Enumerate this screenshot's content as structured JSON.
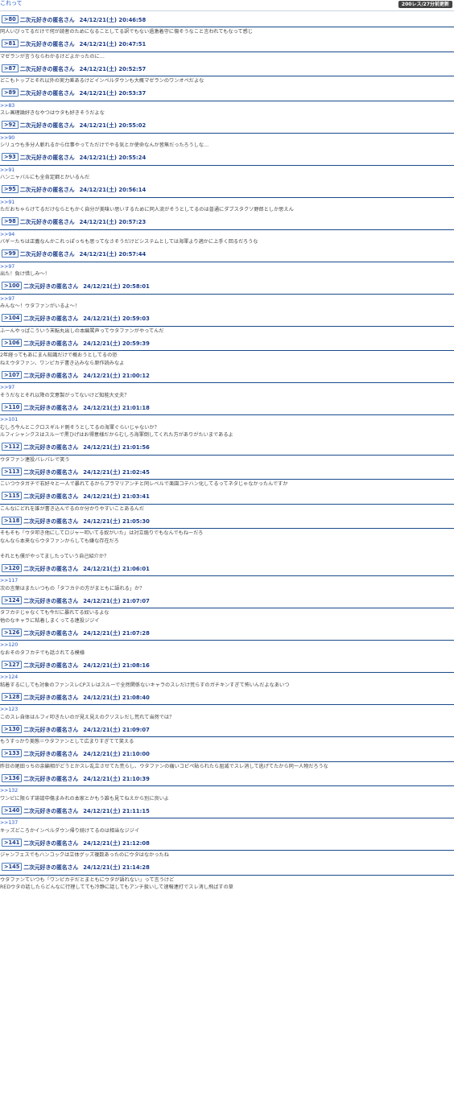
{
  "header": {
    "link_text": "これって",
    "count_badge": "200レス/27分前更新"
  },
  "posts": [
    {
      "num": "80",
      "name": "二次元好きの匿名さん",
      "date": "24/12/21(土) 20:46:58",
      "body": [
        "同人いびってるだけで何が読者のためになることしてる訳でもない過激着守に傷そうなこと言われてもなって感じ"
      ]
    },
    {
      "num": "81",
      "name": "二次元好きの匿名さん",
      "date": "24/12/21(土) 20:47:51",
      "body": [
        "マゼランが言うならわかるけどよかったのに…"
      ]
    },
    {
      "num": "87",
      "name": "二次元好きの匿名さん",
      "date": "24/12/21(土) 20:52:57",
      "body": [
        "どこもトップとそれ以外の実力差あるけどインペルダウンも大概マゼランのワンオペだよな"
      ]
    },
    {
      "num": "89",
      "name": "二次元好きの匿名さん",
      "date": "24/12/21(土) 20:53:37",
      "body": [
        ">>83",
        "スレ画理論好きなやつはウタも好きそうだよな"
      ]
    },
    {
      "num": "92",
      "name": "二次元好きの匿名さん",
      "date": "24/12/21(土) 20:55:02",
      "body": [
        ">>90",
        "シリュウも多分人斬れるから仕事やってただけでやる気とか使命なんか皆無だったろうしな…"
      ]
    },
    {
      "num": "93",
      "name": "二次元好きの匿名さん",
      "date": "24/12/21(土) 20:55:24",
      "body": [
        ">>91",
        "ハンニャバルにも全肯定鋼とかいるんだ"
      ]
    },
    {
      "num": "95",
      "name": "二次元好きの匿名さん",
      "date": "24/12/21(土) 20:56:14",
      "body": [
        ">>91",
        "ただおちゃらけてるだけならともかく自分が美味い思いするために同人流がそうとしてるのは普通にダブスタクソ野郎としか思えん"
      ]
    },
    {
      "num": "98",
      "name": "二次元好きの匿名さん",
      "date": "24/12/21(土) 20:57:23",
      "body": [
        ">>94",
        "バギーたちは正義なんかこれっぽっちも思ってなさそうだけどシステムとしては海軍より適かに上手く回るだろうな"
      ]
    },
    {
      "num": "99",
      "name": "二次元好きの匿名さん",
      "date": "24/12/21(土) 20:57:44",
      "body": [
        ">>97",
        "出た！負け惜しみ～！"
      ]
    },
    {
      "num": "100",
      "name": "二次元好きの匿名さん",
      "date": "24/12/21(土) 20:58:01",
      "body": [
        ">>97",
        "みんな～！ウタファンがいるよ～！"
      ]
    },
    {
      "num": "104",
      "name": "二次元好きの匿名さん",
      "date": "24/12/21(土) 20:59:03",
      "body": [
        "ふーんやっぱこういう末転丸出しの本編罵声ってウタファンがやってんだ"
      ]
    },
    {
      "num": "106",
      "name": "二次元好きの匿名さん",
      "date": "24/12/21(土) 20:59:39",
      "body": [
        "2年経ってもあにまん知識だけで概おうとしてるの恐",
        "ねえウタファン、ワンピカデ書き込みなら原作読みなよ"
      ]
    },
    {
      "num": "107",
      "name": "二次元好きの匿名さん",
      "date": "24/12/21(土) 21:00:12",
      "body": [
        ">>97",
        "そうだなとそれ以降の文意製がってないけど知能大丈夫？"
      ]
    },
    {
      "num": "110",
      "name": "二次元好きの匿名さん",
      "date": "24/12/21(土) 21:01:18",
      "body": [
        ">>101",
        "むしろ今んとこクロスギルド側そうとしてるの海軍ぐらいじゃないか？",
        "ルフィシャンクスはスルーで黒ひげはお得意様だからむしろ海軍倒してくれた方がありがたいまであるよ"
      ]
    },
    {
      "num": "112",
      "name": "二次元好きの匿名さん",
      "date": "24/12/21(土) 21:01:56",
      "body": [
        "ウタファン連投バレバレで笑う"
      ]
    },
    {
      "num": "113",
      "name": "二次元好きの匿名さん",
      "date": "24/12/21(土) 21:02:45",
      "body": [
        "こいつウタガチで右好々と一人で暴れてるからプラマリアンチと同レベルで楽園コテハン化してるってネタじゃなかったんですか"
      ]
    },
    {
      "num": "115",
      "name": "二次元好きの匿名さん",
      "date": "24/12/21(土) 21:03:41",
      "body": [
        "こんなにどれを誰が書き込んでるのか分かりやすいことあるんだ"
      ]
    },
    {
      "num": "118",
      "name": "二次元好きの匿名さん",
      "date": "24/12/21(土) 21:05:30",
      "body": [
        "そもそも「ウタ叩き他にしてロジャー叩いてる奴がいた」は対立煽りでもなんでもねーだろ",
        "なんなら本来ならウタファンからしても嫌な存在だろ",
        "",
        "それとも僕がやってましたっていう自己紹介か？"
      ]
    },
    {
      "num": "120",
      "name": "二次元好きの匿名さん",
      "date": "24/12/21(土) 21:06:01",
      "body": [
        ">>117",
        "次の言葉はまたいつもの「タフカテの方がまともに語れる」か？"
      ]
    },
    {
      "num": "124",
      "name": "二次元好きの匿名さん",
      "date": "24/12/21(土) 21:07:07",
      "body": [
        "タフカテじゃなくても今だに暴れてる奴いるよな",
        "他のなキャラに粘着しまくってる連投ジジイ"
      ]
    },
    {
      "num": "126",
      "name": "二次元好きの匿名さん",
      "date": "24/12/21(土) 21:07:28",
      "body": [
        ">>120",
        "なおそのタフカテでも話されてる模様"
      ]
    },
    {
      "num": "127",
      "name": "二次元好きの匿名さん",
      "date": "24/12/21(土) 21:08:16",
      "body": [
        ">>124",
        "粘着するにしても対象のファンスレCPスレはスルーで全然関係ないキャラのスレだけ荒らすのガチキンすぎて怖いんだよなあいつ"
      ]
    },
    {
      "num": "128",
      "name": "二次元好きの匿名さん",
      "date": "24/12/21(土) 21:08:40",
      "body": [
        ">>123",
        "このスレ自体はルフィ叩きたいのが見え見えのクソスレだし荒れて当然では？"
      ]
    },
    {
      "num": "130",
      "name": "二次元好きの匿名さん",
      "date": "24/12/21(土) 21:09:07",
      "body": [
        "もうすっかり美態＝ウタファンとして広まりすぎてて笑える"
      ]
    },
    {
      "num": "133",
      "name": "二次元好きの匿名さん",
      "date": "24/12/21(土) 21:10:00",
      "body": [
        "昨日の尾田っちの余編相がどうとかスレ乱立させてた荒らし、ウタファンの痛いコピペ貼られたら屈滅でスレ消して逃げてたから同一人物だろうな"
      ]
    },
    {
      "num": "136",
      "name": "二次元好きの匿名さん",
      "date": "24/12/21(土) 21:10:39",
      "body": [
        ">>132",
        "ワンピに限らず誹謗中傷まみれの本家とかもう誰も見てねえから別に良いよ"
      ]
    },
    {
      "num": "140",
      "name": "二次元好きの匿名さん",
      "date": "24/12/21(土) 21:11:15",
      "body": [
        ">>137",
        "キッズどころかインペルダウン帰り続けてるのは相当なジジイ"
      ]
    },
    {
      "num": "141",
      "name": "二次元好きの匿名さん",
      "date": "24/12/21(土) 21:12:08",
      "body": [
        "ジャンフェスでもハンコックは立体グッズ複数あったのにウタはなかったね"
      ]
    },
    {
      "num": "145",
      "name": "二次元好きの匿名さん",
      "date": "24/12/21(土) 21:14:28",
      "body": [
        "ウタファンていつも「ワンピカデだとまともにウタが語れない」って言うけど",
        "REDウタの話したらどんなに行理してても冷静に話してもアンチ扱いして速報連打でスレ消し飛ばすの草"
      ]
    }
  ]
}
